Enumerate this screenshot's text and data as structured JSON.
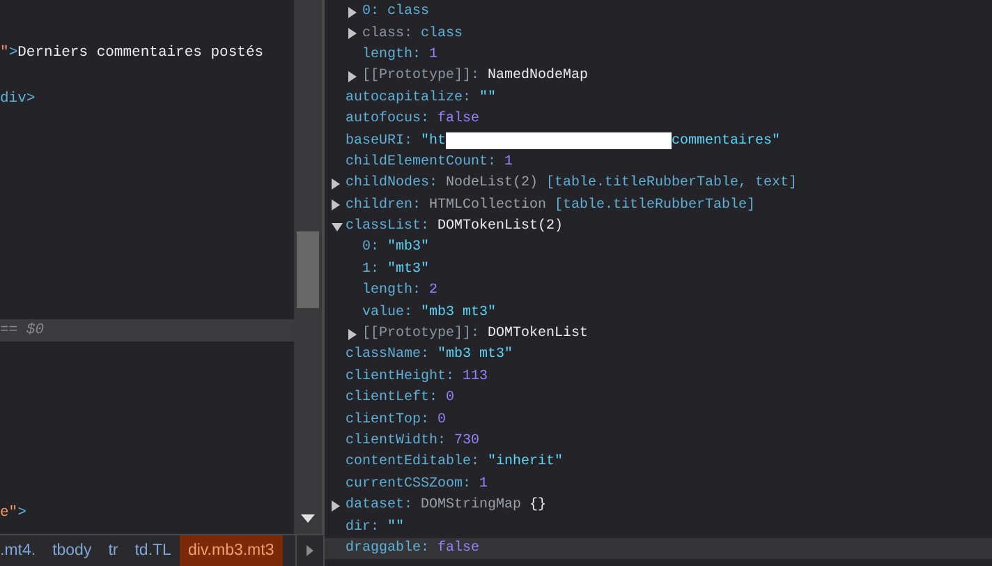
{
  "elements_panel": {
    "lines": [
      {
        "selected": false,
        "parts": [
          {
            "kind": "attr-value",
            "text": "\""
          },
          {
            "kind": "tag",
            "text": ">"
          },
          {
            "kind": "text",
            "text": "Derniers commentaires postés"
          }
        ]
      },
      {
        "selected": false,
        "parts": [
          {
            "kind": "tag",
            "text": "div>"
          }
        ]
      },
      {
        "selected": true,
        "parts": [
          {
            "kind": "marker",
            "text": "== $0"
          }
        ]
      },
      {
        "selected": false,
        "parts": [
          {
            "kind": "attr-value",
            "text": "e\""
          },
          {
            "kind": "tag",
            "text": ">"
          }
        ]
      }
    ]
  },
  "breadcrumbs": [
    {
      "label": ".mt4.",
      "selected": false
    },
    {
      "label": "tbody",
      "selected": false
    },
    {
      "label": "tr",
      "selected": false
    },
    {
      "label": "td.TL",
      "selected": false
    },
    {
      "label": "div.mb3.mt3",
      "selected": true
    }
  ],
  "properties_panel": {
    "rows": [
      {
        "children": [
          {
            "key": "0:",
            "expandable": true,
            "expanded": false,
            "dim": false,
            "highlighted": false,
            "value": [
              {
                "kind": "preview",
                "text": "class"
              }
            ]
          },
          {
            "key": "class:",
            "expandable": true,
            "expanded": false,
            "dim": true,
            "highlighted": false,
            "value": [
              {
                "kind": "preview",
                "text": "class"
              }
            ]
          },
          {
            "key": "length:",
            "expandable": false,
            "dim": false,
            "highlighted": false,
            "value": [
              {
                "kind": "number",
                "text": "1"
              }
            ]
          },
          {
            "key": "[[Prototype]]:",
            "expandable": true,
            "expanded": false,
            "dim": true,
            "highlighted": false,
            "value": [
              {
                "kind": "object",
                "text": "NamedNodeMap"
              }
            ]
          }
        ]
      },
      {
        "key": "autocapitalize:",
        "expandable": false,
        "dim": false,
        "highlighted": false,
        "value": [
          {
            "kind": "string",
            "text": "\"\""
          }
        ]
      },
      {
        "key": "autofocus:",
        "expandable": false,
        "dim": false,
        "highlighted": false,
        "value": [
          {
            "kind": "number",
            "text": "false"
          }
        ]
      },
      {
        "key": "baseURI:",
        "expandable": false,
        "dim": false,
        "highlighted": false,
        "value": [
          {
            "kind": "string",
            "text": "\"ht"
          },
          {
            "kind": "redacted"
          },
          {
            "kind": "string",
            "text": "commentaires\""
          }
        ]
      },
      {
        "key": "childElementCount:",
        "expandable": false,
        "dim": false,
        "highlighted": false,
        "value": [
          {
            "kind": "number",
            "text": "1"
          }
        ]
      },
      {
        "key": "childNodes:",
        "expandable": true,
        "expanded": false,
        "dim": false,
        "highlighted": false,
        "value": [
          {
            "kind": "type",
            "text": "NodeList(2)"
          },
          {
            "kind": "preview",
            "text": "[table.titleRubberTable, text]"
          }
        ]
      },
      {
        "key": "children:",
        "expandable": true,
        "expanded": false,
        "dim": false,
        "highlighted": false,
        "value": [
          {
            "kind": "type",
            "text": "HTMLCollection"
          },
          {
            "kind": "preview",
            "text": "[table.titleRubberTable]"
          }
        ]
      },
      {
        "key": "classList:",
        "expandable": true,
        "expanded": true,
        "dim": false,
        "highlighted": false,
        "value": [
          {
            "kind": "object",
            "text": "DOMTokenList(2)"
          }
        ],
        "children": [
          {
            "key": "0:",
            "expandable": false,
            "dim": false,
            "highlighted": false,
            "value": [
              {
                "kind": "string",
                "text": "\"mb3\""
              }
            ]
          },
          {
            "key": "1:",
            "expandable": false,
            "dim": false,
            "highlighted": false,
            "value": [
              {
                "kind": "string",
                "text": "\"mt3\""
              }
            ]
          },
          {
            "key": "length:",
            "expandable": false,
            "dim": false,
            "highlighted": false,
            "value": [
              {
                "kind": "number",
                "text": "2"
              }
            ]
          },
          {
            "key": "value:",
            "expandable": false,
            "dim": false,
            "highlighted": false,
            "value": [
              {
                "kind": "string",
                "text": "\"mb3 mt3\""
              }
            ]
          },
          {
            "key": "[[Prototype]]:",
            "expandable": true,
            "expanded": false,
            "dim": true,
            "highlighted": false,
            "value": [
              {
                "kind": "object",
                "text": "DOMTokenList"
              }
            ]
          }
        ]
      },
      {
        "key": "className:",
        "expandable": false,
        "dim": false,
        "highlighted": false,
        "value": [
          {
            "kind": "string",
            "text": "\"mb3 mt3\""
          }
        ]
      },
      {
        "key": "clientHeight:",
        "expandable": false,
        "dim": false,
        "highlighted": false,
        "value": [
          {
            "kind": "number",
            "text": "113"
          }
        ]
      },
      {
        "key": "clientLeft:",
        "expandable": false,
        "dim": false,
        "highlighted": false,
        "value": [
          {
            "kind": "number",
            "text": "0"
          }
        ]
      },
      {
        "key": "clientTop:",
        "expandable": false,
        "dim": false,
        "highlighted": false,
        "value": [
          {
            "kind": "number",
            "text": "0"
          }
        ]
      },
      {
        "key": "clientWidth:",
        "expandable": false,
        "dim": false,
        "highlighted": false,
        "value": [
          {
            "kind": "number",
            "text": "730"
          }
        ]
      },
      {
        "key": "contentEditable:",
        "expandable": false,
        "dim": false,
        "highlighted": false,
        "value": [
          {
            "kind": "string",
            "text": "\"inherit\""
          }
        ]
      },
      {
        "key": "currentCSSZoom:",
        "expandable": false,
        "dim": false,
        "highlighted": false,
        "value": [
          {
            "kind": "number",
            "text": "1"
          }
        ]
      },
      {
        "key": "dataset:",
        "expandable": true,
        "expanded": false,
        "dim": false,
        "highlighted": false,
        "value": [
          {
            "kind": "type",
            "text": "DOMStringMap"
          },
          {
            "kind": "object",
            "text": "{}"
          }
        ]
      },
      {
        "key": "dir:",
        "expandable": false,
        "dim": false,
        "highlighted": false,
        "value": [
          {
            "kind": "string",
            "text": "\"\""
          }
        ]
      },
      {
        "key": "draggable:",
        "expandable": false,
        "dim": false,
        "highlighted": true,
        "value": [
          {
            "kind": "number",
            "text": "false"
          }
        ]
      }
    ]
  }
}
